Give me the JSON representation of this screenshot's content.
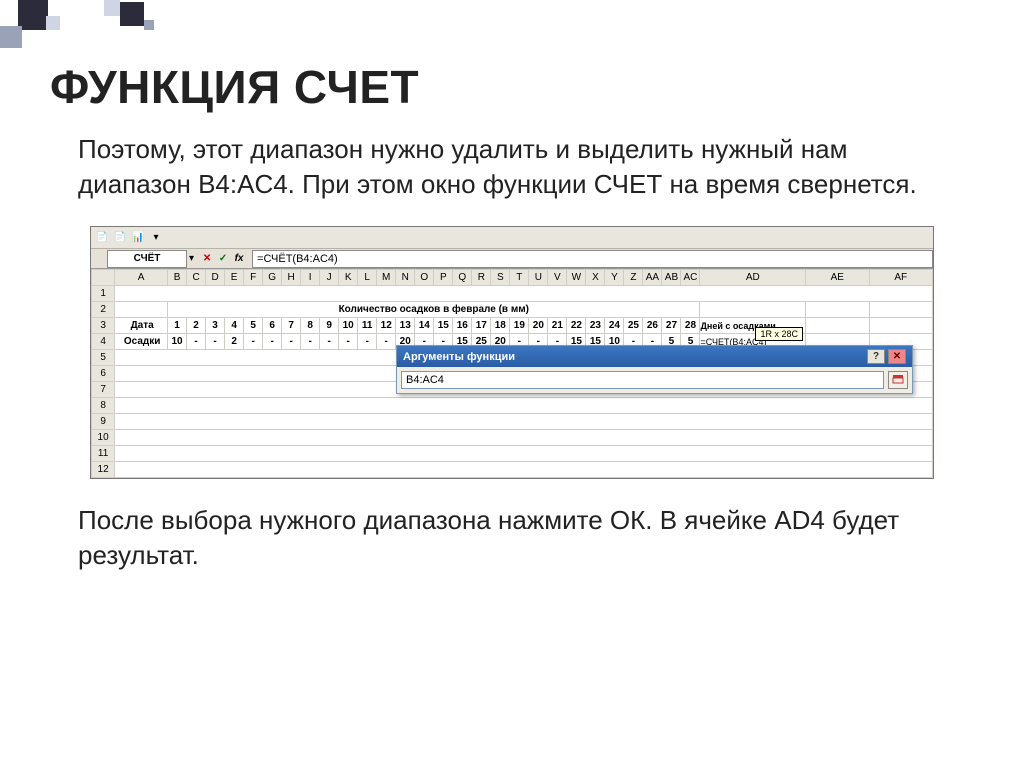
{
  "title": "ФУНКЦИЯ СЧЕТ",
  "para1": "Поэтому, этот диапазон нужно удалить и выделить нужный нам диапазон  B4:AC4. При этом окно функции СЧЕТ на время свернется.",
  "para2": "После выбора нужного диапазона нажмите ОК. В ячейке AD4 будет результат.",
  "excel": {
    "namebox": "СЧЁТ",
    "formula": "=СЧЁТ(B4:AC4)",
    "col_headers": [
      "A",
      "B",
      "C",
      "D",
      "E",
      "F",
      "G",
      "H",
      "I",
      "J",
      "K",
      "L",
      "M",
      "N",
      "O",
      "P",
      "Q",
      "R",
      "S",
      "T",
      "U",
      "V",
      "W",
      "X",
      "Y",
      "Z",
      "AA",
      "AB",
      "AC",
      "AD",
      "AE",
      "AF"
    ],
    "row_numbers": [
      "1",
      "2",
      "3",
      "4",
      "5",
      "6",
      "7",
      "8",
      "9",
      "10",
      "11",
      "12"
    ],
    "row2_title": "Количество осадков в феврале (в мм)",
    "row3": {
      "label": "Дата",
      "values": [
        "1",
        "2",
        "3",
        "4",
        "5",
        "6",
        "7",
        "8",
        "9",
        "10",
        "11",
        "12",
        "13",
        "14",
        "15",
        "16",
        "17",
        "18",
        "19",
        "20",
        "21",
        "22",
        "23",
        "24",
        "25",
        "26",
        "27",
        "28"
      ],
      "ad": "Дней с осадками"
    },
    "row4": {
      "label": "Осадки",
      "values": [
        "10",
        "-",
        "-",
        "2",
        "-",
        "-",
        "-",
        "-",
        "-",
        "-",
        "-",
        "-",
        "20",
        "-",
        "-",
        "15",
        "25",
        "20",
        "-",
        "-",
        "-",
        "15",
        "15",
        "10",
        "-",
        "-",
        "5",
        "5"
      ],
      "ad": "=СЧЕТ(B4:AC4)"
    },
    "tooltip": "1R x 28C",
    "dialog": {
      "title": "Аргументы функции",
      "input": "B4:AC4"
    }
  }
}
